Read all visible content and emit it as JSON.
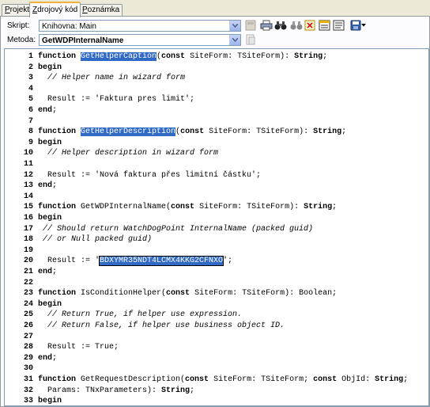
{
  "tabs": [
    {
      "pre": "",
      "u": "P",
      "post": "rojekt",
      "active": false
    },
    {
      "pre": "",
      "u": "Z",
      "post": "drojový kód",
      "active": true
    },
    {
      "pre": "",
      "u": "P",
      "post": "oznámka",
      "active": false
    }
  ],
  "script_row": {
    "label": "Skript:",
    "value": "Knihovna: Main"
  },
  "method_row": {
    "label": "Metoda:",
    "value": "GetWDPInternalName"
  },
  "toolbar_icons": [
    "save-db-icon",
    "print-icon",
    "binoculars-icon",
    "binoculars-next-icon",
    "cut-icon",
    "form-icon",
    "document-icon",
    "save-disk-icon"
  ],
  "colors": {
    "selection": "#316ac5",
    "border": "#7f9db9"
  },
  "code": [
    {
      "n": "1",
      "y": 0,
      "segs": [
        {
          "t": "function ",
          "k": "kw"
        },
        {
          "t": "GetHelperCaption",
          "k": "hl"
        },
        {
          "t": "(",
          "k": ""
        },
        {
          "t": "const",
          "k": "kw"
        },
        {
          "t": " SiteForm: TSiteForm): ",
          "k": ""
        },
        {
          "t": "String",
          "k": "kw"
        },
        {
          "t": ";",
          "k": ""
        }
      ]
    },
    {
      "n": "2",
      "y": 1,
      "segs": [
        {
          "t": "begin",
          "k": "kw"
        }
      ]
    },
    {
      "n": "3",
      "y": 2,
      "segs": [
        {
          "t": "  // Helper name in wizard form",
          "k": "cm"
        }
      ]
    },
    {
      "n": "4",
      "y": 3,
      "segs": []
    },
    {
      "n": "5",
      "y": 4,
      "segs": [
        {
          "t": "  Result := 'Faktura pres limit';",
          "k": ""
        }
      ]
    },
    {
      "n": "6",
      "y": 5,
      "segs": [
        {
          "t": "end",
          "k": "kw"
        },
        {
          "t": ";",
          "k": ""
        }
      ]
    },
    {
      "n": "7",
      "y": 6,
      "segs": []
    },
    {
      "n": "8",
      "y": 7,
      "segs": [
        {
          "t": "function ",
          "k": "kw"
        },
        {
          "t": "GetHelperDescription",
          "k": "hl"
        },
        {
          "t": "(",
          "k": ""
        },
        {
          "t": "const",
          "k": "kw"
        },
        {
          "t": " SiteForm: TSiteForm): ",
          "k": ""
        },
        {
          "t": "String",
          "k": "kw"
        },
        {
          "t": ";",
          "k": ""
        }
      ]
    },
    {
      "n": "9",
      "y": 8,
      "segs": [
        {
          "t": "begin",
          "k": "kw"
        }
      ]
    },
    {
      "n": "10",
      "y": 9,
      "segs": [
        {
          "t": "  // Helper description in wizard form",
          "k": "cm"
        }
      ]
    },
    {
      "n": "11",
      "y": 10,
      "segs": []
    },
    {
      "n": "12",
      "y": 11,
      "segs": [
        {
          "t": "  Result := 'Nová faktura přes limitní částku';",
          "k": ""
        }
      ]
    },
    {
      "n": "13",
      "y": 12,
      "segs": [
        {
          "t": "end",
          "k": "kw"
        },
        {
          "t": ";",
          "k": ""
        }
      ]
    },
    {
      "n": "14",
      "y": 13,
      "segs": []
    },
    {
      "n": "15",
      "y": 14,
      "segs": [
        {
          "t": "function ",
          "k": "kw"
        },
        {
          "t": "GetWDPInternalName(",
          "k": ""
        },
        {
          "t": "const",
          "k": "kw"
        },
        {
          "t": " SiteForm: TSiteForm): ",
          "k": ""
        },
        {
          "t": "String",
          "k": "kw"
        },
        {
          "t": ";",
          "k": ""
        }
      ]
    },
    {
      "n": "16",
      "y": 15,
      "segs": [
        {
          "t": "begin",
          "k": "kw"
        }
      ]
    },
    {
      "n": "17",
      "y": 16,
      "segs": [
        {
          "t": " // Should return WatchDogPoint InternalName (packed guid)",
          "k": "cm"
        }
      ]
    },
    {
      "n": "18",
      "y": 17,
      "segs": [
        {
          "t": " // or Null packed guid)",
          "k": "cm"
        }
      ]
    },
    {
      "n": "19",
      "y": 18,
      "segs": []
    },
    {
      "n": "20",
      "y": 19,
      "segs": [
        {
          "t": "  Result := '",
          "k": ""
        },
        {
          "t": "BDXYMR35NDT4LCMX4KKG2CFNXO",
          "k": "hlbox"
        },
        {
          "t": "';",
          "k": ""
        }
      ]
    },
    {
      "n": "21",
      "y": 20,
      "segs": [
        {
          "t": "end",
          "k": "kw"
        },
        {
          "t": ";",
          "k": ""
        }
      ]
    },
    {
      "n": "22",
      "y": 21,
      "segs": []
    },
    {
      "n": "23",
      "y": 22,
      "segs": [
        {
          "t": "function ",
          "k": "kw"
        },
        {
          "t": "IsConditionHelper(",
          "k": ""
        },
        {
          "t": "const",
          "k": "kw"
        },
        {
          "t": " SiteForm: TSiteForm): Boolean;",
          "k": ""
        }
      ]
    },
    {
      "n": "24",
      "y": 23,
      "segs": [
        {
          "t": "begin",
          "k": "kw"
        }
      ]
    },
    {
      "n": "25",
      "y": 24,
      "segs": [
        {
          "t": "  // Return True, if helper use expression.",
          "k": "cm"
        }
      ]
    },
    {
      "n": "26",
      "y": 25,
      "segs": [
        {
          "t": "  // Return False, if helper use business object ID.",
          "k": "cm"
        }
      ]
    },
    {
      "n": "27",
      "y": 26,
      "segs": []
    },
    {
      "n": "28",
      "y": 27,
      "segs": [
        {
          "t": "  Result := True;",
          "k": ""
        }
      ]
    },
    {
      "n": "29",
      "y": 28,
      "segs": [
        {
          "t": "end",
          "k": "kw"
        },
        {
          "t": ";",
          "k": ""
        }
      ]
    },
    {
      "n": "30",
      "y": 29,
      "segs": []
    },
    {
      "n": "31",
      "y": 30,
      "segs": [
        {
          "t": "function ",
          "k": "kw"
        },
        {
          "t": "GetRequestDescription(",
          "k": ""
        },
        {
          "t": "const",
          "k": "kw"
        },
        {
          "t": " SiteForm: TSiteForm; ",
          "k": ""
        },
        {
          "t": "const",
          "k": "kw"
        },
        {
          "t": " ObjId: ",
          "k": ""
        },
        {
          "t": "String",
          "k": "kw"
        },
        {
          "t": ";",
          "k": ""
        }
      ]
    },
    {
      "n": "32",
      "y": 31,
      "segs": [
        {
          "t": "  Params: TNxParameters): ",
          "k": ""
        },
        {
          "t": "String",
          "k": "kw"
        },
        {
          "t": ";",
          "k": ""
        }
      ]
    },
    {
      "n": "33",
      "y": 32,
      "segs": [
        {
          "t": "begin",
          "k": "kw"
        }
      ]
    }
  ]
}
